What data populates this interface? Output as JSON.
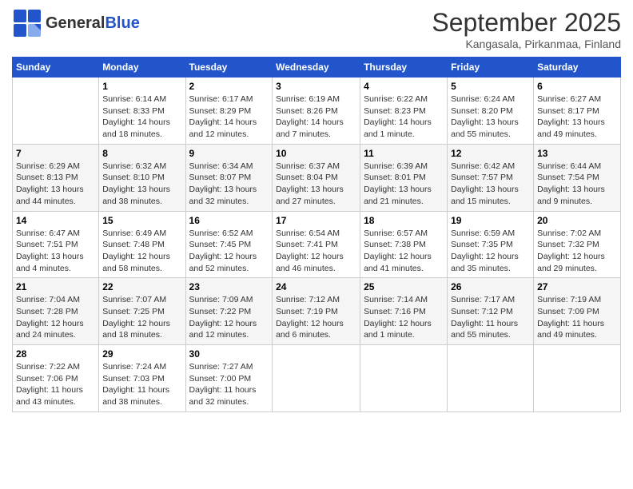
{
  "header": {
    "logo_general": "General",
    "logo_blue": "Blue",
    "month": "September 2025",
    "location": "Kangasala, Pirkanmaa, Finland"
  },
  "days_of_week": [
    "Sunday",
    "Monday",
    "Tuesday",
    "Wednesday",
    "Thursday",
    "Friday",
    "Saturday"
  ],
  "weeks": [
    [
      {
        "day": "",
        "info": ""
      },
      {
        "day": "1",
        "info": "Sunrise: 6:14 AM\nSunset: 8:33 PM\nDaylight: 14 hours\nand 18 minutes."
      },
      {
        "day": "2",
        "info": "Sunrise: 6:17 AM\nSunset: 8:29 PM\nDaylight: 14 hours\nand 12 minutes."
      },
      {
        "day": "3",
        "info": "Sunrise: 6:19 AM\nSunset: 8:26 PM\nDaylight: 14 hours\nand 7 minutes."
      },
      {
        "day": "4",
        "info": "Sunrise: 6:22 AM\nSunset: 8:23 PM\nDaylight: 14 hours\nand 1 minute."
      },
      {
        "day": "5",
        "info": "Sunrise: 6:24 AM\nSunset: 8:20 PM\nDaylight: 13 hours\nand 55 minutes."
      },
      {
        "day": "6",
        "info": "Sunrise: 6:27 AM\nSunset: 8:17 PM\nDaylight: 13 hours\nand 49 minutes."
      }
    ],
    [
      {
        "day": "7",
        "info": "Sunrise: 6:29 AM\nSunset: 8:13 PM\nDaylight: 13 hours\nand 44 minutes."
      },
      {
        "day": "8",
        "info": "Sunrise: 6:32 AM\nSunset: 8:10 PM\nDaylight: 13 hours\nand 38 minutes."
      },
      {
        "day": "9",
        "info": "Sunrise: 6:34 AM\nSunset: 8:07 PM\nDaylight: 13 hours\nand 32 minutes."
      },
      {
        "day": "10",
        "info": "Sunrise: 6:37 AM\nSunset: 8:04 PM\nDaylight: 13 hours\nand 27 minutes."
      },
      {
        "day": "11",
        "info": "Sunrise: 6:39 AM\nSunset: 8:01 PM\nDaylight: 13 hours\nand 21 minutes."
      },
      {
        "day": "12",
        "info": "Sunrise: 6:42 AM\nSunset: 7:57 PM\nDaylight: 13 hours\nand 15 minutes."
      },
      {
        "day": "13",
        "info": "Sunrise: 6:44 AM\nSunset: 7:54 PM\nDaylight: 13 hours\nand 9 minutes."
      }
    ],
    [
      {
        "day": "14",
        "info": "Sunrise: 6:47 AM\nSunset: 7:51 PM\nDaylight: 13 hours\nand 4 minutes."
      },
      {
        "day": "15",
        "info": "Sunrise: 6:49 AM\nSunset: 7:48 PM\nDaylight: 12 hours\nand 58 minutes."
      },
      {
        "day": "16",
        "info": "Sunrise: 6:52 AM\nSunset: 7:45 PM\nDaylight: 12 hours\nand 52 minutes."
      },
      {
        "day": "17",
        "info": "Sunrise: 6:54 AM\nSunset: 7:41 PM\nDaylight: 12 hours\nand 46 minutes."
      },
      {
        "day": "18",
        "info": "Sunrise: 6:57 AM\nSunset: 7:38 PM\nDaylight: 12 hours\nand 41 minutes."
      },
      {
        "day": "19",
        "info": "Sunrise: 6:59 AM\nSunset: 7:35 PM\nDaylight: 12 hours\nand 35 minutes."
      },
      {
        "day": "20",
        "info": "Sunrise: 7:02 AM\nSunset: 7:32 PM\nDaylight: 12 hours\nand 29 minutes."
      }
    ],
    [
      {
        "day": "21",
        "info": "Sunrise: 7:04 AM\nSunset: 7:28 PM\nDaylight: 12 hours\nand 24 minutes."
      },
      {
        "day": "22",
        "info": "Sunrise: 7:07 AM\nSunset: 7:25 PM\nDaylight: 12 hours\nand 18 minutes."
      },
      {
        "day": "23",
        "info": "Sunrise: 7:09 AM\nSunset: 7:22 PM\nDaylight: 12 hours\nand 12 minutes."
      },
      {
        "day": "24",
        "info": "Sunrise: 7:12 AM\nSunset: 7:19 PM\nDaylight: 12 hours\nand 6 minutes."
      },
      {
        "day": "25",
        "info": "Sunrise: 7:14 AM\nSunset: 7:16 PM\nDaylight: 12 hours\nand 1 minute."
      },
      {
        "day": "26",
        "info": "Sunrise: 7:17 AM\nSunset: 7:12 PM\nDaylight: 11 hours\nand 55 minutes."
      },
      {
        "day": "27",
        "info": "Sunrise: 7:19 AM\nSunset: 7:09 PM\nDaylight: 11 hours\nand 49 minutes."
      }
    ],
    [
      {
        "day": "28",
        "info": "Sunrise: 7:22 AM\nSunset: 7:06 PM\nDaylight: 11 hours\nand 43 minutes."
      },
      {
        "day": "29",
        "info": "Sunrise: 7:24 AM\nSunset: 7:03 PM\nDaylight: 11 hours\nand 38 minutes."
      },
      {
        "day": "30",
        "info": "Sunrise: 7:27 AM\nSunset: 7:00 PM\nDaylight: 11 hours\nand 32 minutes."
      },
      {
        "day": "",
        "info": ""
      },
      {
        "day": "",
        "info": ""
      },
      {
        "day": "",
        "info": ""
      },
      {
        "day": "",
        "info": ""
      }
    ]
  ]
}
